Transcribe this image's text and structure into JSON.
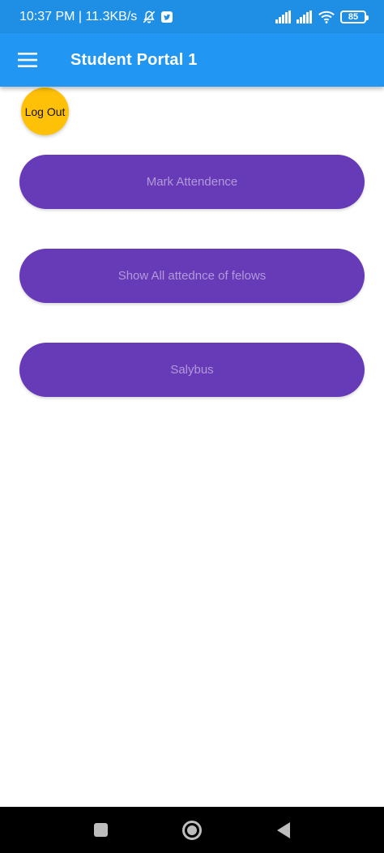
{
  "status_bar": {
    "time_speed": "10:37 PM | 11.3KB/s",
    "battery_level": "85",
    "icons": [
      "bell-off-icon",
      "twitter-icon",
      "signal-icon",
      "signal-icon",
      "wifi-icon",
      "battery-icon"
    ]
  },
  "app_bar": {
    "title": "Student Portal 1",
    "menu_icon": "hamburger-menu-icon"
  },
  "logout": {
    "label": "Log Out"
  },
  "actions": {
    "mark_attendance": "Mark Attendence",
    "show_attendance": "Show All attednce of felows",
    "syllabus": "Salybus"
  },
  "nav_bar": {
    "icons": [
      "recent-apps-icon",
      "home-icon",
      "back-icon"
    ]
  },
  "colors": {
    "status_bar": "#1f8fe6",
    "app_bar": "#2196f3",
    "logout_button": "#ffc107",
    "action_button": "#673ab7",
    "action_text": "#b39ad9"
  }
}
